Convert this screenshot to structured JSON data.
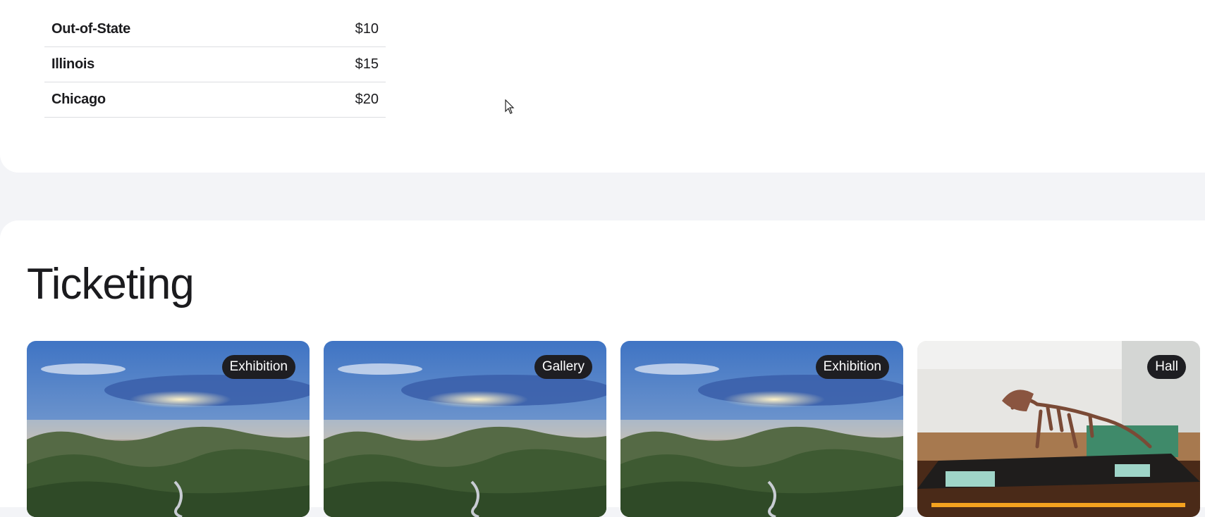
{
  "pricing": {
    "rows": [
      {
        "label": "Out-of-State",
        "price": "$10"
      },
      {
        "label": "Illinois",
        "price": "$15"
      },
      {
        "label": "Chicago",
        "price": "$20"
      }
    ]
  },
  "ticketing": {
    "title": "Ticketing",
    "cards": [
      {
        "badge": "Exhibition",
        "image": "forest-sunrise"
      },
      {
        "badge": "Gallery",
        "image": "forest-sunrise"
      },
      {
        "badge": "Exhibition",
        "image": "forest-sunrise"
      },
      {
        "badge": "Hall",
        "image": "dinosaur-hall"
      }
    ]
  }
}
